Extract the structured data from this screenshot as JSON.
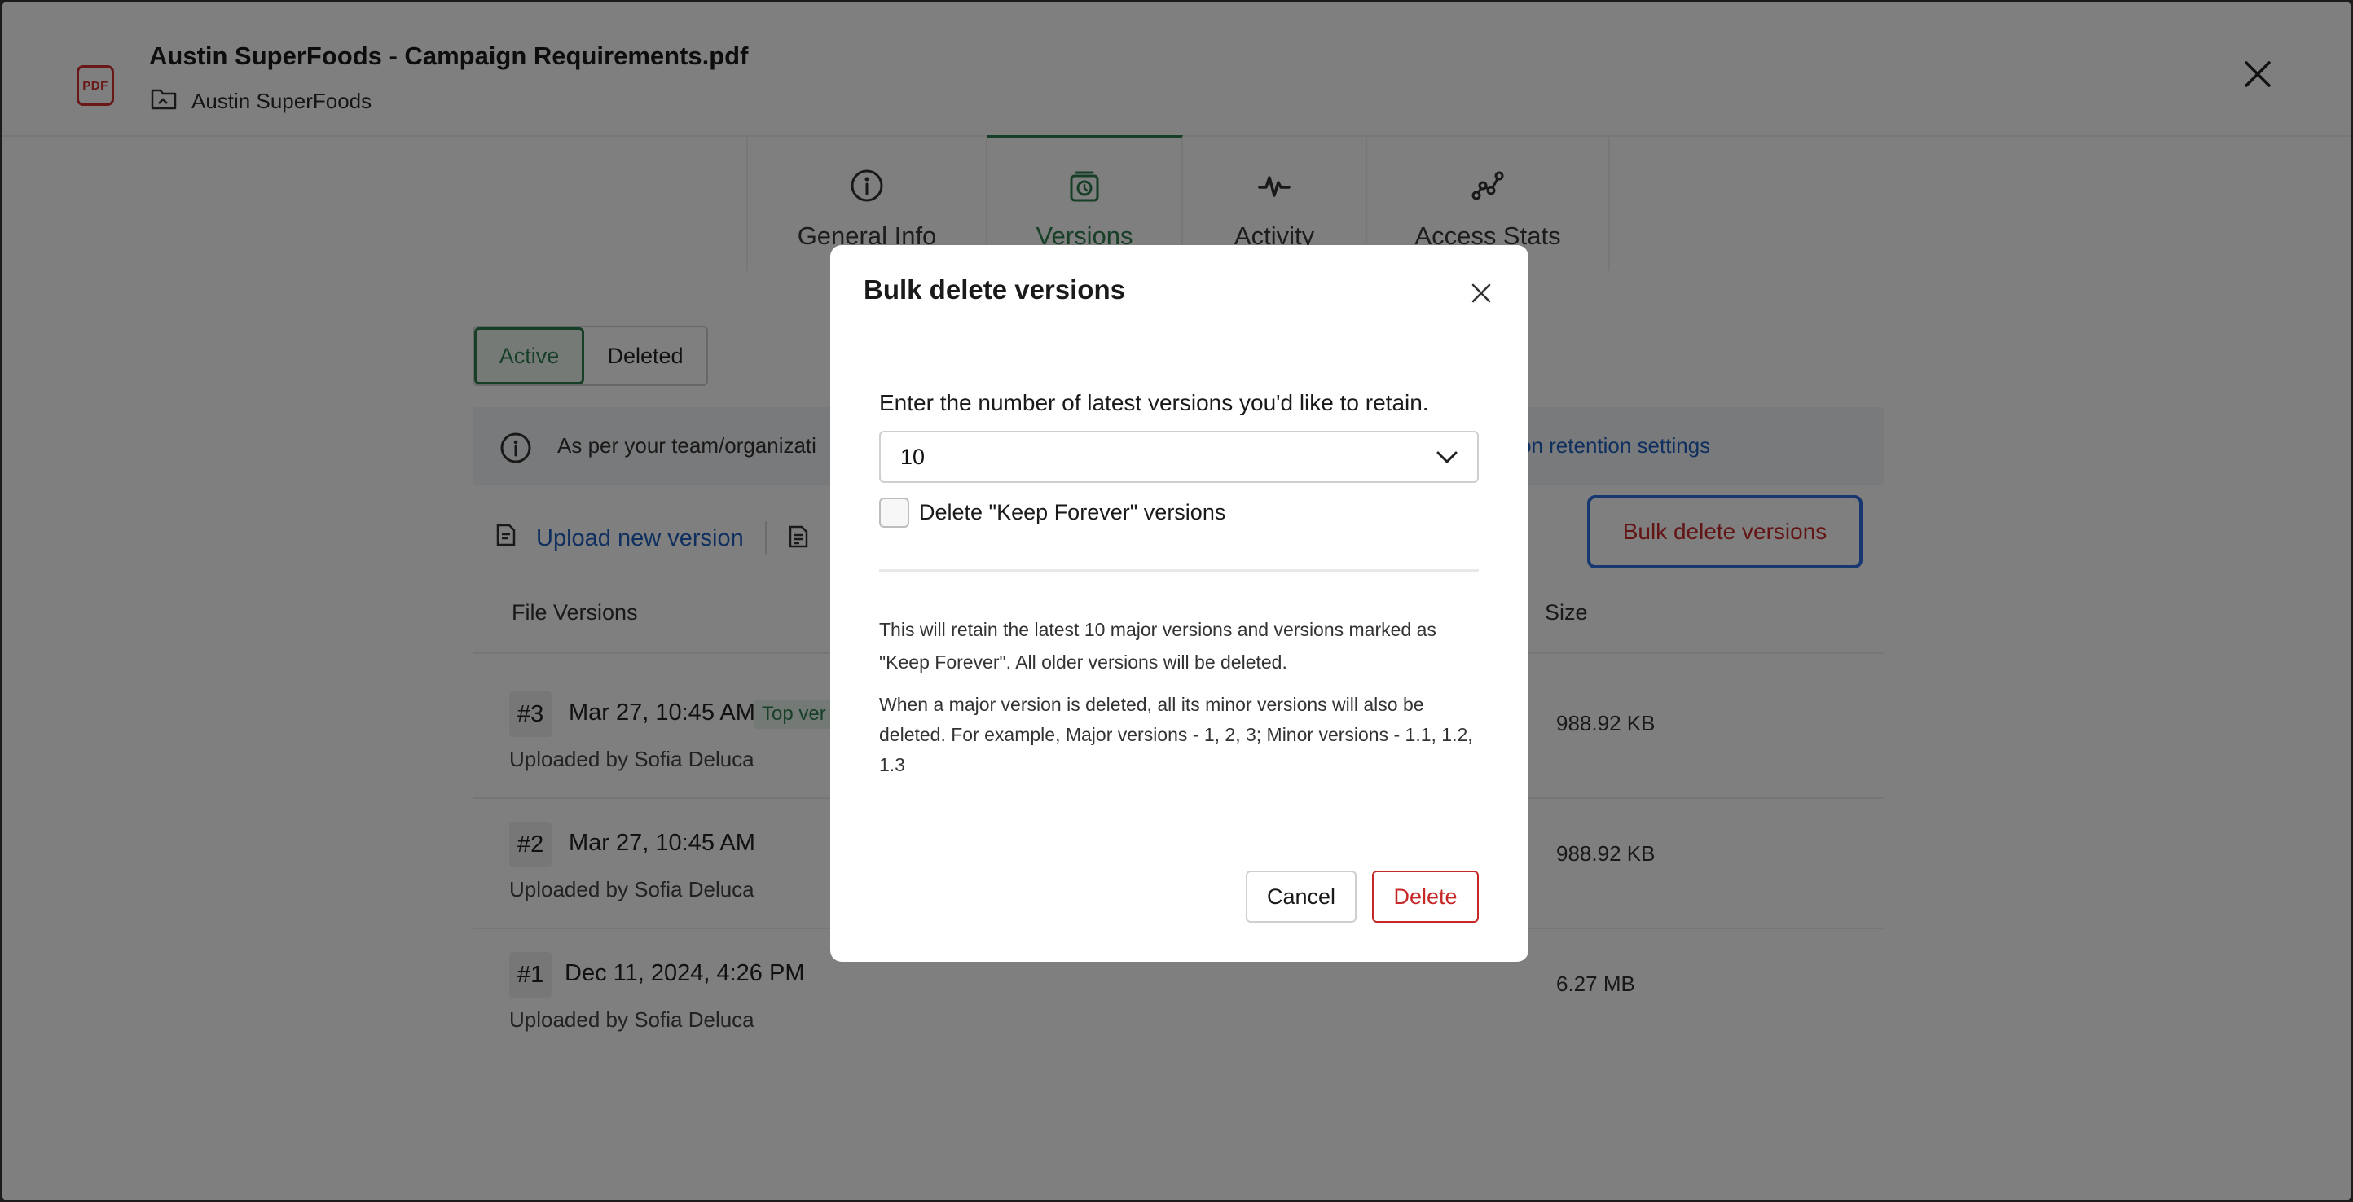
{
  "header": {
    "file_icon_label": "PDF",
    "file_title": "Austin SuperFoods - Campaign Requirements.pdf",
    "folder_name": "Austin SuperFoods"
  },
  "tabs": [
    {
      "label": "General Info",
      "icon": "info-icon"
    },
    {
      "label": "Versions",
      "icon": "version-history-icon",
      "active": true
    },
    {
      "label": "Activity",
      "icon": "activity-pulse-icon"
    },
    {
      "label": "Access Stats",
      "icon": "stats-chart-icon"
    }
  ],
  "filter": {
    "active_label": "Active",
    "deleted_label": "Deleted"
  },
  "notice": {
    "text": "As per your team/organizati",
    "link": "on retention settings"
  },
  "toolbar": {
    "upload_label": "Upload new version",
    "bulk_delete_label": "Bulk delete versions"
  },
  "table": {
    "col_versions": "File Versions",
    "col_size": "Size",
    "rows": [
      {
        "num": "#3",
        "date": "Mar 27, 10:45 AM",
        "badge": "Top ver",
        "uploaded_by": "Uploaded by Sofia Deluca",
        "size": "988.92 KB"
      },
      {
        "num": "#2",
        "date": "Mar 27, 10:45 AM",
        "badge": "",
        "uploaded_by": "Uploaded by Sofia Deluca",
        "size": "988.92 KB"
      },
      {
        "num": "#1",
        "date": "Dec 11, 2024, 4:26 PM",
        "badge": "",
        "uploaded_by": "Uploaded by Sofia Deluca",
        "size": "6.27 MB"
      }
    ]
  },
  "modal": {
    "title": "Bulk delete versions",
    "prompt": "Enter the number of latest versions you'd like to retain.",
    "selected_value": "10",
    "checkbox_label": "Delete \"Keep Forever\" versions",
    "info_1": "This will retain the latest 10 major versions and versions marked as \"Keep Forever\". All older versions will be deleted.",
    "info_2": "When a major version is deleted, all its minor versions will also be deleted. For example, Major versions - 1, 2, 3; Minor versions - 1.1, 1.2, 1.3",
    "cancel_label": "Cancel",
    "delete_label": "Delete"
  },
  "colors": {
    "accent_green": "#2e7d4f",
    "danger_red": "#c62828",
    "link_blue": "#1f5fbf",
    "focus_blue": "#2f6fe0"
  }
}
